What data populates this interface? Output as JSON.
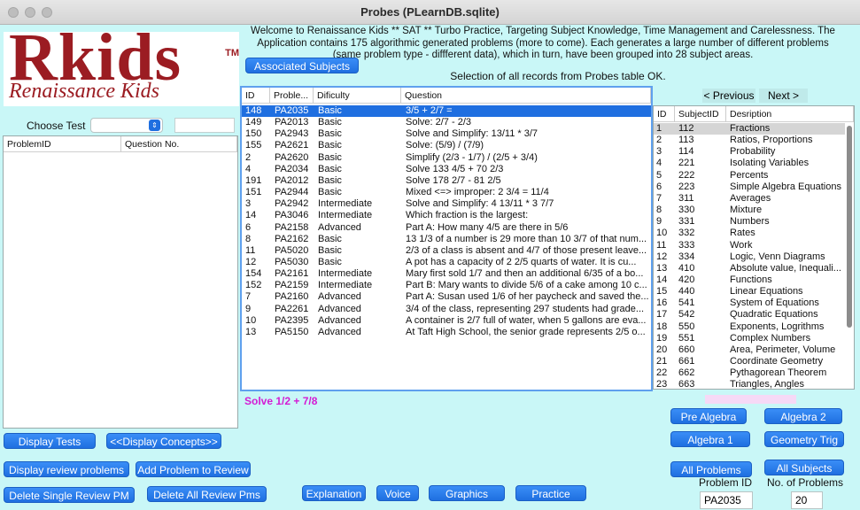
{
  "window": {
    "title": "Probes (PLearnDB.sqlite)"
  },
  "logo": {
    "big": "Rkids",
    "tm": "TM",
    "sub": "Renaissance Kids"
  },
  "welcome": "Welcome to Renaissance Kids ** SAT ** Turbo Practice, Targeting Subject Knowledge, Time Management and Carelessness. The Application contains 175 algorithmic generated problems (more to come). Each generates a large number of different problems (same problem type - diffferent data), which in turn, have been grouped into 28 subject areas.",
  "status": "Selection of all records from Probes table OK.",
  "associated_subjects_label": "Associated Subjects",
  "choose_test": {
    "label": "Choose Test",
    "value": ""
  },
  "left_table": {
    "headers": [
      "ProblemID",
      "Question No."
    ]
  },
  "probes_table": {
    "headers": [
      "ID",
      "Proble...",
      "Dificulty",
      "Question"
    ],
    "rows": [
      [
        "148",
        "PA2035",
        "Basic",
        "3/5 + 2/7 ="
      ],
      [
        "149",
        "PA2013",
        "Basic",
        "Solve: 2/7 - 2/3"
      ],
      [
        "150",
        "PA2943",
        "Basic",
        "Solve and Simplify:  13/11 * 3/7"
      ],
      [
        "155",
        "PA2621",
        "Basic",
        "Solve: (5/9) / (7/9)"
      ],
      [
        "2",
        "PA2620",
        "Basic",
        "Simplify (2/3 - 1/7) / (2/5 + 3/4)"
      ],
      [
        "4",
        "PA2034",
        "Basic",
        "Solve 133  4/5 + 70  2/3"
      ],
      [
        "191",
        "PA2012",
        "Basic",
        "Solve 178  2/7 - 81  2/5"
      ],
      [
        "151",
        "PA2944",
        "Basic",
        "Mixed <=> improper: 2 3/4 = 11/4"
      ],
      [
        "3",
        "PA2942",
        "Intermediate",
        "Solve and Simplify:  4 13/11 * 3 7/7"
      ],
      [
        "14",
        "PA3046",
        "Intermediate",
        "Which fraction is the largest:"
      ],
      [
        "6",
        "PA2158",
        "Advanced",
        "Part A: How many 4/5 are there in 5/6"
      ],
      [
        "8",
        "PA2162",
        "Basic",
        "13 1/3 of a number is 29 more than 10 3/7 of that num..."
      ],
      [
        "11",
        "PA5020",
        "Basic",
        "2/3 of a class is absent and 4/7 of those present leave..."
      ],
      [
        "12",
        "PA5030",
        "Basic",
        "A pot has a capacity of  2  2/5 quarts of water. It is  cu..."
      ],
      [
        "154",
        "PA2161",
        "Intermediate",
        "Mary first sold 1/7 and then an additional 6/35 of a bo..."
      ],
      [
        "152",
        "PA2159",
        "Intermediate",
        "Part B: Mary wants to divide 5/6 of a cake among 10 c..."
      ],
      [
        "7",
        "PA2160",
        "Advanced",
        "Part A: Susan used 1/6 of her paycheck and saved the..."
      ],
      [
        "9",
        "PA2261",
        "Advanced",
        "3/4 of the class, representing 297 students had grade..."
      ],
      [
        "10",
        "PA2395",
        "Advanced",
        "A container is 2/7 full of water, when 5 gallons are eva..."
      ],
      [
        "13",
        "PA5150",
        "Advanced",
        "At Taft High School, the senior grade represents 2/5 o..."
      ]
    ]
  },
  "solve_text": "Solve 1/2 + 7/8",
  "nav": {
    "previous": "< Previous",
    "next": "Next >"
  },
  "subjects_table": {
    "headers": [
      "ID",
      "SubjectID",
      "Desription"
    ],
    "rows": [
      [
        "1",
        "112",
        "Fractions"
      ],
      [
        "2",
        "113",
        "Ratios, Proportions"
      ],
      [
        "3",
        "114",
        "Probability"
      ],
      [
        "4",
        "221",
        "Isolating Variables"
      ],
      [
        "5",
        "222",
        "Percents"
      ],
      [
        "6",
        "223",
        "Simple Algebra Equations"
      ],
      [
        "7",
        "311",
        "Averages"
      ],
      [
        "8",
        "330",
        "Mixture"
      ],
      [
        "9",
        "331",
        "Numbers"
      ],
      [
        "10",
        "332",
        "Rates"
      ],
      [
        "11",
        "333",
        "Work"
      ],
      [
        "12",
        "334",
        "Logic, Venn Diagrams"
      ],
      [
        "13",
        "410",
        "Absolute value, Inequali..."
      ],
      [
        "14",
        "420",
        "Functions"
      ],
      [
        "15",
        "440",
        "Linear Equations"
      ],
      [
        "16",
        "541",
        "System of Equations"
      ],
      [
        "17",
        "542",
        "Quadratic Equations"
      ],
      [
        "18",
        "550",
        "Exponents, Logrithms"
      ],
      [
        "19",
        "551",
        "Complex Numbers"
      ],
      [
        "20",
        "660",
        "Area, Perimeter, Volume"
      ],
      [
        "21",
        "661",
        "Coordinate Geometry"
      ],
      [
        "22",
        "662",
        "Pythagorean Theorem"
      ],
      [
        "23",
        "663",
        "Triangles, Angles"
      ]
    ]
  },
  "buttons": {
    "pre_algebra": "Pre Algebra",
    "algebra2": "Algebra 2",
    "algebra1": "Algebra 1",
    "geometry_trig": "Geometry  Trig",
    "all_problems": "All Problems",
    "all_subjects": "All Subjects",
    "display_tests": "Display Tests",
    "display_concepts": "<<Display Concepts>>",
    "display_review": "Display review problems",
    "add_review": "Add Problem to Review",
    "delete_single": "Delete Single Review PM",
    "delete_all": "Delete All Review Pms",
    "explanation": "Explanation",
    "voice": "Voice",
    "graphics": "Graphics",
    "practice": "Practice"
  },
  "footer": {
    "problem_id_label": "Problem ID",
    "problem_id_value": "PA2035",
    "num_problems_label": "No. of Problems",
    "num_problems_value": "20"
  },
  "colors": {
    "window_bg": "#c9f7f7",
    "button_blue": "#1f6fe0",
    "selection_blue": "#1f6fe0",
    "solve_text": "#d41bd4",
    "logo_red": "#9b1c22"
  }
}
